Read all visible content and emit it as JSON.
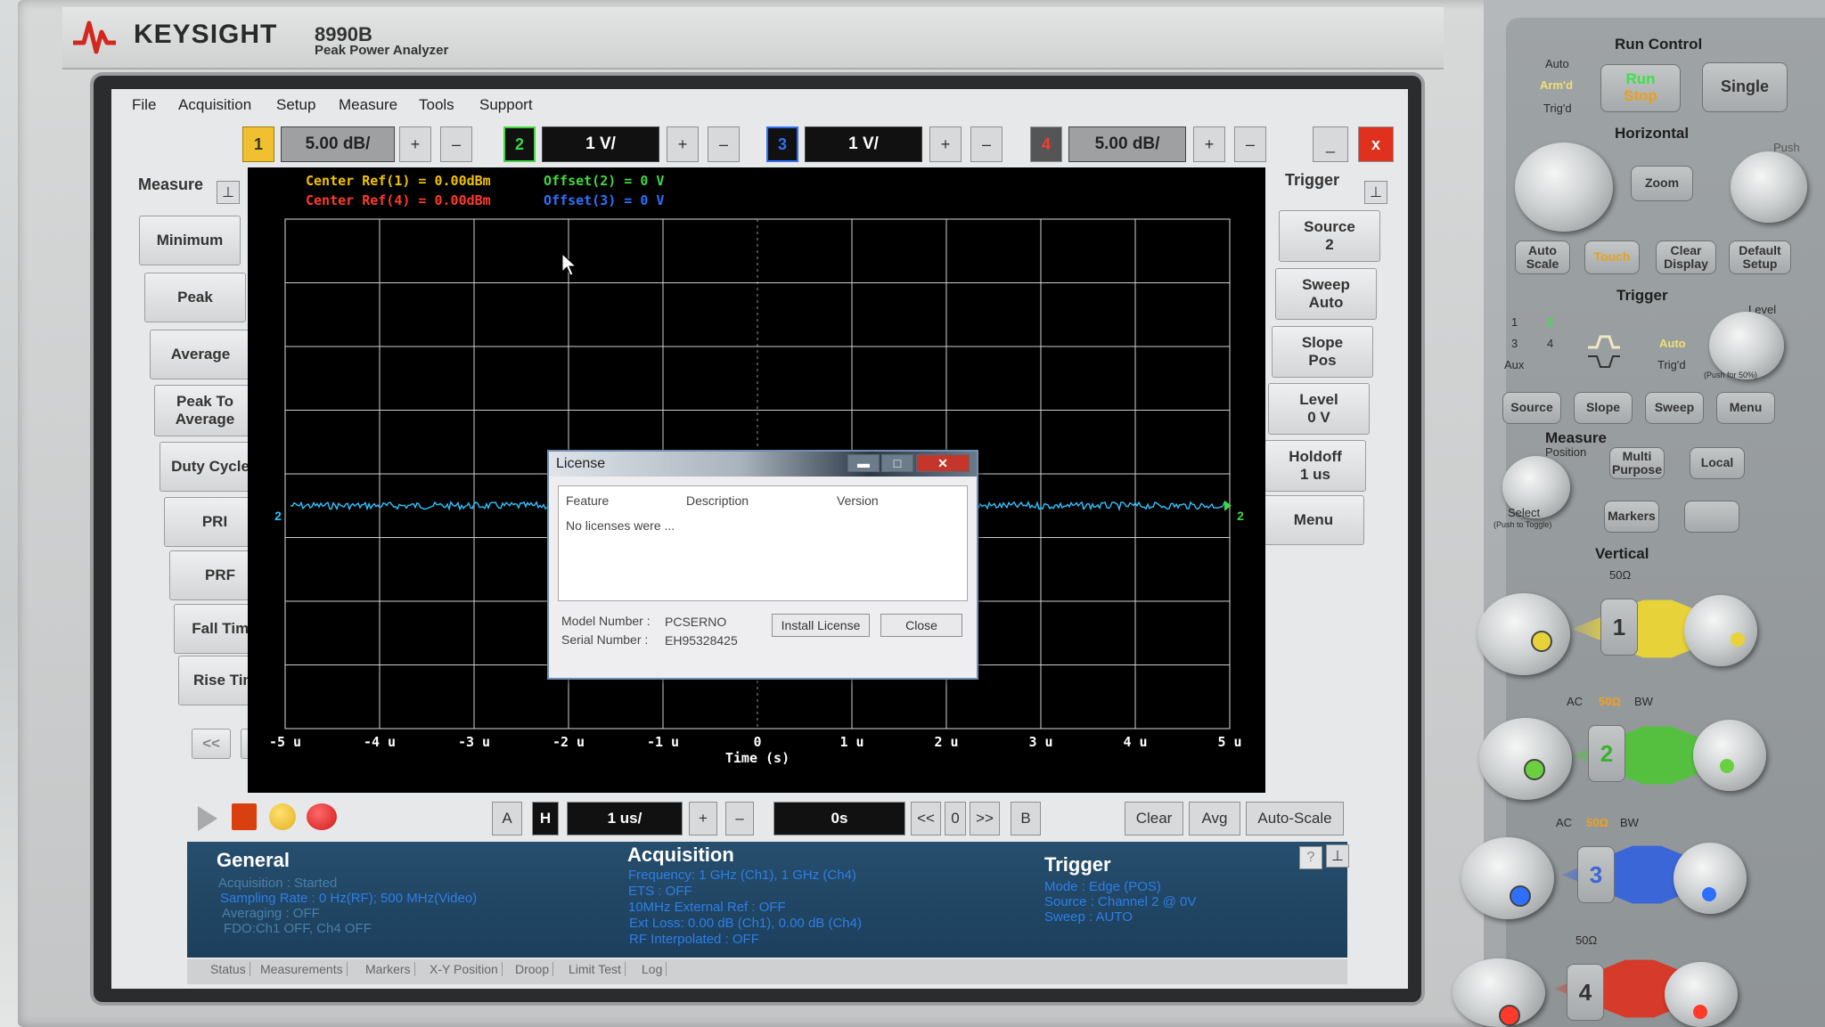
{
  "brand": {
    "name": "KEYSIGHT",
    "model": "8990B",
    "description": "Peak Power Analyzer"
  },
  "menu": [
    "File",
    "Acquisition",
    "Setup",
    "Measure",
    "Tools",
    "Support"
  ],
  "channel_toolbar": {
    "ch1": {
      "label": "1",
      "scale": "5.00 dB/"
    },
    "ch2": {
      "label": "2",
      "scale": "1 V/"
    },
    "ch3": {
      "label": "3",
      "scale": "1 V/"
    },
    "ch4": {
      "label": "4",
      "scale": "5.00 dB/"
    },
    "plus": "+",
    "minus": "–",
    "minimize": "_",
    "close": "x"
  },
  "measure_panel": {
    "title": "Measure",
    "buttons": [
      "Minimum",
      "Peak",
      "Average",
      "Peak To Average",
      "Duty Cycle",
      "PRI",
      "PRF",
      "Fall Time",
      "Rise Time"
    ],
    "prev": "<<",
    "next": ">>"
  },
  "trigger_panel": {
    "title": "Trigger",
    "buttons": [
      {
        "label": "Source",
        "value": "2"
      },
      {
        "label": "Sweep",
        "value": "Auto"
      },
      {
        "label": "Slope",
        "value": "Pos"
      },
      {
        "label": "Level",
        "value": "0 V"
      },
      {
        "label": "Holdoff",
        "value": "1 us"
      },
      {
        "label": "Menu",
        "value": ""
      }
    ]
  },
  "scope": {
    "center_ref_1": "Center Ref(1) = 0.00dBm",
    "center_ref_4": "Center Ref(4) = 0.00dBm",
    "offset_2": "Offset(2) = 0 V",
    "offset_3": "Offset(3) = 0 V",
    "x_tick_labels": [
      "-5 u",
      "-4 u",
      "-3 u",
      "-2 u",
      "-1 u",
      "0",
      "1 u",
      "2 u",
      "3 u",
      "4 u",
      "5 u"
    ],
    "x_axis_title": "Time (s)",
    "trace_marker_left": "2",
    "trace_marker_right": "2",
    "colors": {
      "ch1": "#f2c200",
      "ch2": "#40d840",
      "ch3": "#2f6fff",
      "ch4": "#ff3a2a",
      "trace": "#2fc4ff"
    }
  },
  "license_dialog": {
    "title": "License",
    "columns": [
      "Feature",
      "Description",
      "Version"
    ],
    "empty_text": "No licenses were ...",
    "model_label": "Model Number :",
    "model_value": "PCSERNO",
    "serial_label": "Serial Number :",
    "serial_value": "EH95328425",
    "install_button": "Install License",
    "close_button": "Close"
  },
  "bottom_toolbar": {
    "a": "A",
    "h": "H",
    "timebase": "1 us/",
    "plus": "+",
    "minus": "–",
    "delay": "0s",
    "prev": "<<",
    "zero": "0",
    "next": ">>",
    "b": "B",
    "clear": "Clear",
    "avg": "Avg",
    "autoscale": "Auto-Scale"
  },
  "info": {
    "general_title": "General",
    "general_lines": [
      "Acquisition : Started",
      "Sampling Rate : 0 Hz(RF); 500 MHz(Video)",
      "Averaging : OFF",
      "FDO:Ch1 OFF, Ch4 OFF"
    ],
    "acq_title": "Acquisition",
    "acq_lines": [
      "Frequency: 1 GHz (Ch1), 1 GHz (Ch4)",
      "ETS : OFF",
      "10MHz External Ref : OFF",
      "Ext Loss: 0.00 dB (Ch1), 0.00 dB (Ch4)",
      "RF Interpolated : OFF"
    ],
    "trig_title": "Trigger",
    "trig_lines": [
      "Mode : Edge (POS)",
      "Source : Channel 2 @ 0V",
      "Sweep : AUTO"
    ],
    "help": "?"
  },
  "tabs": [
    "Status",
    "Measurements",
    "Markers",
    "X-Y Position",
    "Droop",
    "Limit Test",
    "Log"
  ],
  "front_panel": {
    "run_control": "Run Control",
    "auto": "Auto",
    "armd": "Arm'd",
    "trigd": "Trig'd",
    "run": "Run",
    "stop": "Stop",
    "single": "Single",
    "horizontal": "Horizontal",
    "push": "Push",
    "zoom": "Zoom",
    "auto_scale": "Auto Scale",
    "touch": "Touch",
    "clear_display": "Clear Display",
    "default_setup": "Default Setup",
    "trigger": "Trigger",
    "level": "Level",
    "ch_nums": [
      "1",
      "2",
      "3",
      "4"
    ],
    "aux": "Aux",
    "trig_auto": "Auto",
    "trig_trigd": "Trig'd",
    "push_50": "(Push for 50%)",
    "source": "Source",
    "slope": "Slope",
    "sweep": "Sweep",
    "menu": "Menu",
    "measure": "Measure",
    "position": "Position",
    "multi_purpose": "Multi Purpose",
    "local": "Local",
    "select": "Select",
    "push_toggle": "(Push to Toggle)",
    "markers": "Markers",
    "vertical": "Vertical",
    "ohm": "50Ω",
    "ac": "AC",
    "ohm_lit": "50Ω",
    "bw": "BW",
    "ch1": "1",
    "ch2": "2",
    "ch3": "3",
    "ch4": "4"
  }
}
